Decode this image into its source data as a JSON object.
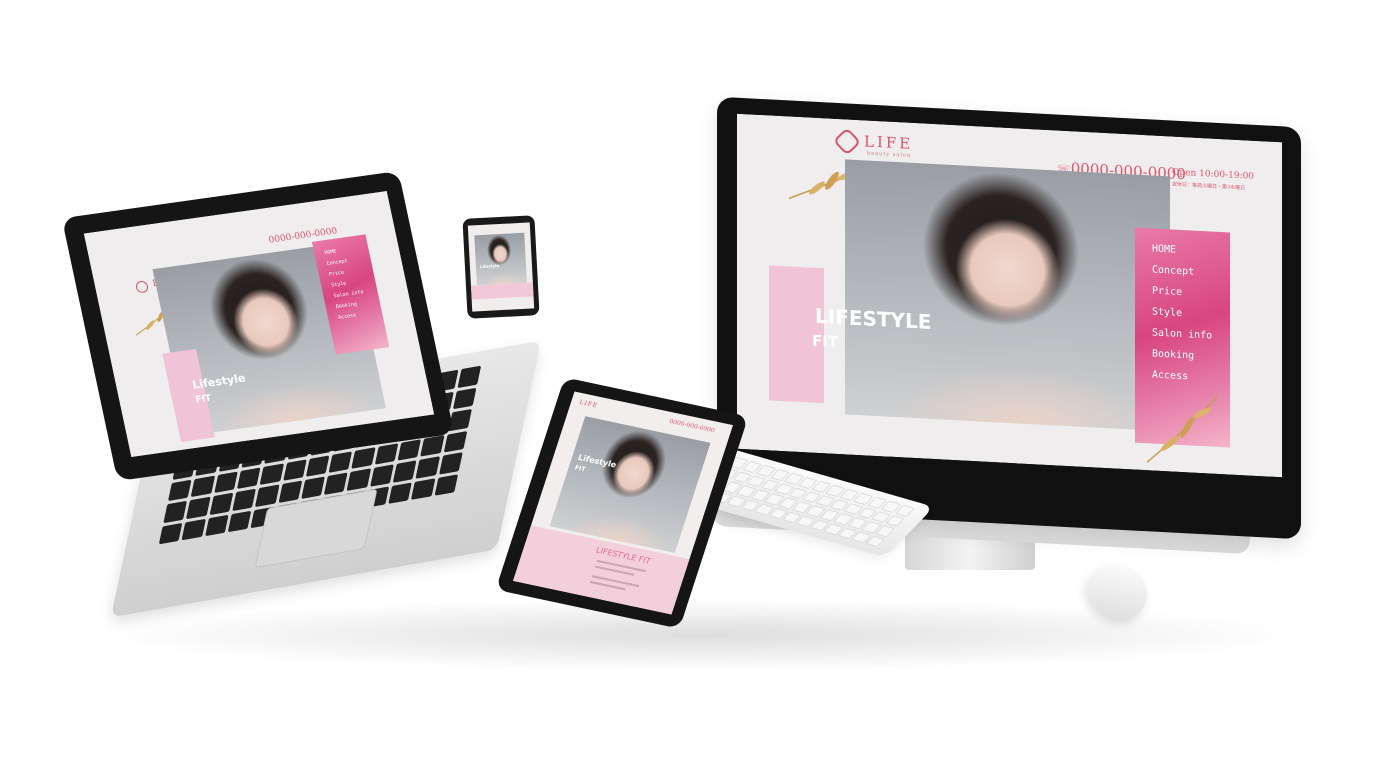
{
  "brand": {
    "logo_text": "LIFE",
    "logo_mark": "L",
    "tagline": "beauty salon"
  },
  "header": {
    "phone": "0000-000-0000",
    "hours": "Open 10:00-19:00",
    "hours_sub": "定休日：毎週火曜日・第3水曜日"
  },
  "nav": {
    "items": [
      "HOME",
      "Concept",
      "Price",
      "Style",
      "Salon info",
      "Booking",
      "Access"
    ]
  },
  "hero": {
    "line1": "Lifestyle",
    "line2": "FIT"
  },
  "tablet": {
    "logo_text": "LIFE",
    "phone": "0000-000-0000",
    "hero_line1": "Lifestyle",
    "hero_line2": "FIT",
    "section_title": "LIFESTYLE FIT"
  },
  "colors": {
    "accent": "#d9546a",
    "pink": "#e05d8f",
    "screen_bg": "#efeded"
  },
  "icons": {
    "leaf": "gold-leaf-icon",
    "logo": "hexagon-logo-icon",
    "phone": "phone-icon"
  }
}
